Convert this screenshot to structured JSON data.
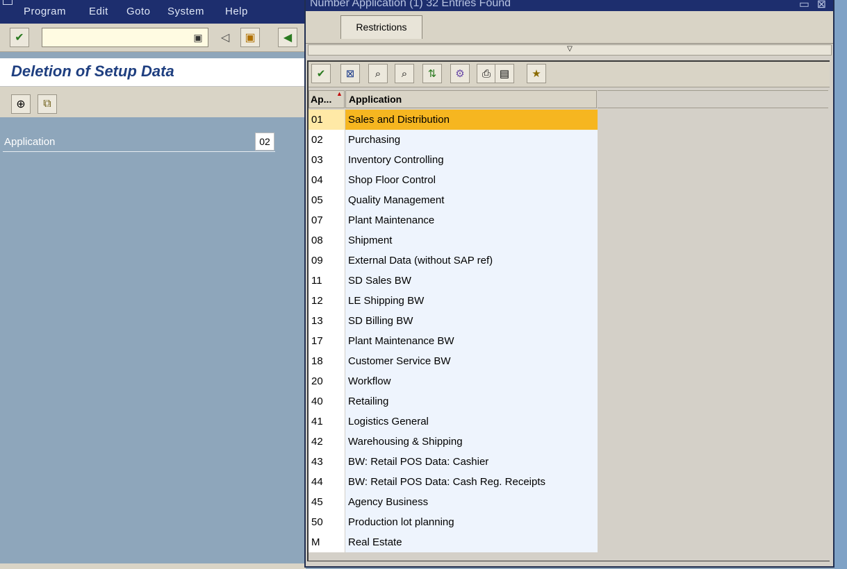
{
  "menubar": {
    "items": [
      "Program",
      "Edit",
      "Goto",
      "System",
      "Help"
    ]
  },
  "page": {
    "title": "Deletion of Setup Data"
  },
  "form": {
    "application_label": "Application",
    "application_value": "02"
  },
  "popup": {
    "title": "Number Application (1)   32 Entries Found",
    "tab_label": "Restrictions",
    "columns": {
      "code": "Ap...",
      "application": "Application"
    },
    "rows": [
      {
        "code": "01",
        "name": "Sales and Distribution",
        "selected": true
      },
      {
        "code": "02",
        "name": "Purchasing"
      },
      {
        "code": "03",
        "name": "Inventory Controlling"
      },
      {
        "code": "04",
        "name": "Shop Floor Control"
      },
      {
        "code": "05",
        "name": "Quality Management"
      },
      {
        "code": "07",
        "name": "Plant Maintenance"
      },
      {
        "code": "08",
        "name": "Shipment"
      },
      {
        "code": "09",
        "name": "External Data (without SAP ref)"
      },
      {
        "code": "11",
        "name": "SD Sales BW"
      },
      {
        "code": "12",
        "name": "LE Shipping BW"
      },
      {
        "code": "13",
        "name": "SD Billing BW"
      },
      {
        "code": "17",
        "name": "Plant Maintenance BW"
      },
      {
        "code": "18",
        "name": "Customer Service BW"
      },
      {
        "code": "20",
        "name": "Workflow"
      },
      {
        "code": "40",
        "name": "Retailing"
      },
      {
        "code": "41",
        "name": "Logistics General"
      },
      {
        "code": "42",
        "name": "Warehousing & Shipping"
      },
      {
        "code": "43",
        "name": "BW: Retail POS Data: Cashier"
      },
      {
        "code": "44",
        "name": "BW: Retail POS Data: Cash Reg. Receipts"
      },
      {
        "code": "45",
        "name": "Agency Business"
      },
      {
        "code": "50",
        "name": "Production lot planning"
      },
      {
        "code": "M",
        "name": "Real Estate"
      }
    ]
  },
  "colors": {
    "menubar": "#1d2e6e",
    "selection": "#f6b620",
    "title": "#1f3f80",
    "background": "#8ea6bb"
  }
}
